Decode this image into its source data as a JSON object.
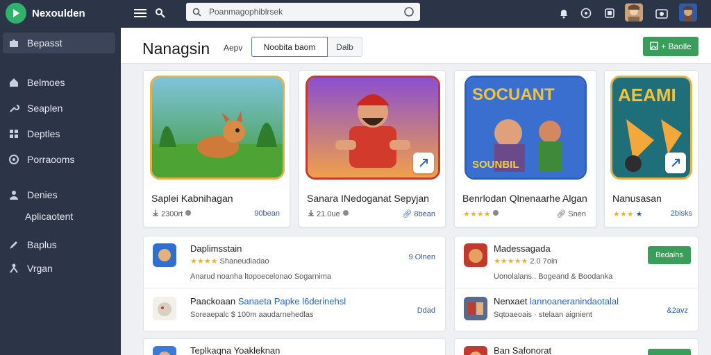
{
  "app": {
    "name": "Nexoulden"
  },
  "sidebar": {
    "items": [
      {
        "label": "Bepasst",
        "icon": "puzzle-icon"
      },
      {
        "label": "Belmoes",
        "icon": "home-icon"
      },
      {
        "label": "Seaplen",
        "icon": "wrench-icon"
      },
      {
        "label": "Deptles",
        "icon": "grid-icon"
      },
      {
        "label": "Porraooms",
        "icon": "settings-icon"
      },
      {
        "label": "Denies",
        "icon": "user-icon"
      },
      {
        "label": "Aplicaotent",
        "icon": ""
      },
      {
        "label": "Baplus",
        "icon": "pen-icon"
      },
      {
        "label": "Vrgan",
        "icon": "person-icon"
      }
    ]
  },
  "topbar": {
    "search_placeholder": "Poanmagophiblrsek"
  },
  "header": {
    "title": "Nanagsin",
    "sort_label": "Aepv",
    "seg_a": "Noobita baom",
    "seg_b": "Dalb",
    "add_label": "+ Baolle"
  },
  "featured": [
    {
      "title": "Saplei Kabnihagan",
      "meta": "2300rt",
      "price": "90bean"
    },
    {
      "title": "Sanara INedoganat Sepyjan",
      "meta": "21.0ue",
      "price": "8bean"
    },
    {
      "title": "Benrlodan Qlnenaarhe Algan",
      "meta": "",
      "price": "Snen"
    },
    {
      "title": "Nanusasan",
      "meta": "",
      "price": "2bisks"
    }
  ],
  "featured_art": [
    {
      "text": ""
    },
    {
      "text": ""
    },
    {
      "text": "SOCUANT",
      "text2": "SOUNBIL"
    },
    {
      "text": "AEAMI"
    }
  ],
  "left_list": [
    {
      "name": "Daplimsstain",
      "sub": "Shaneudiadao",
      "right": "9 Olnen",
      "desc": "Anarud noanha ltopoecelonao Sogarnima"
    },
    {
      "name": "Paackoaan",
      "name_link": "Sanaeta Papke l6derinehsl",
      "sub": "Soreaepalc $ 100m aaudarnehedlas",
      "right": "Ddad"
    },
    {
      "name": "Teplkaqna Yoakleknan"
    }
  ],
  "right_list": [
    {
      "name": "Madessagada",
      "sub": "2.0 7oin",
      "action": "Bedaihs",
      "desc": "Uonolalans.. Bogeand & Boodanka"
    },
    {
      "name": "Nenxaet",
      "name_link": "lannoaneranindaotalal",
      "sub": "Sqtoaeoais · stelaan aignient",
      "right": "&2avz"
    },
    {
      "name": "Ban Safonorat"
    }
  ]
}
